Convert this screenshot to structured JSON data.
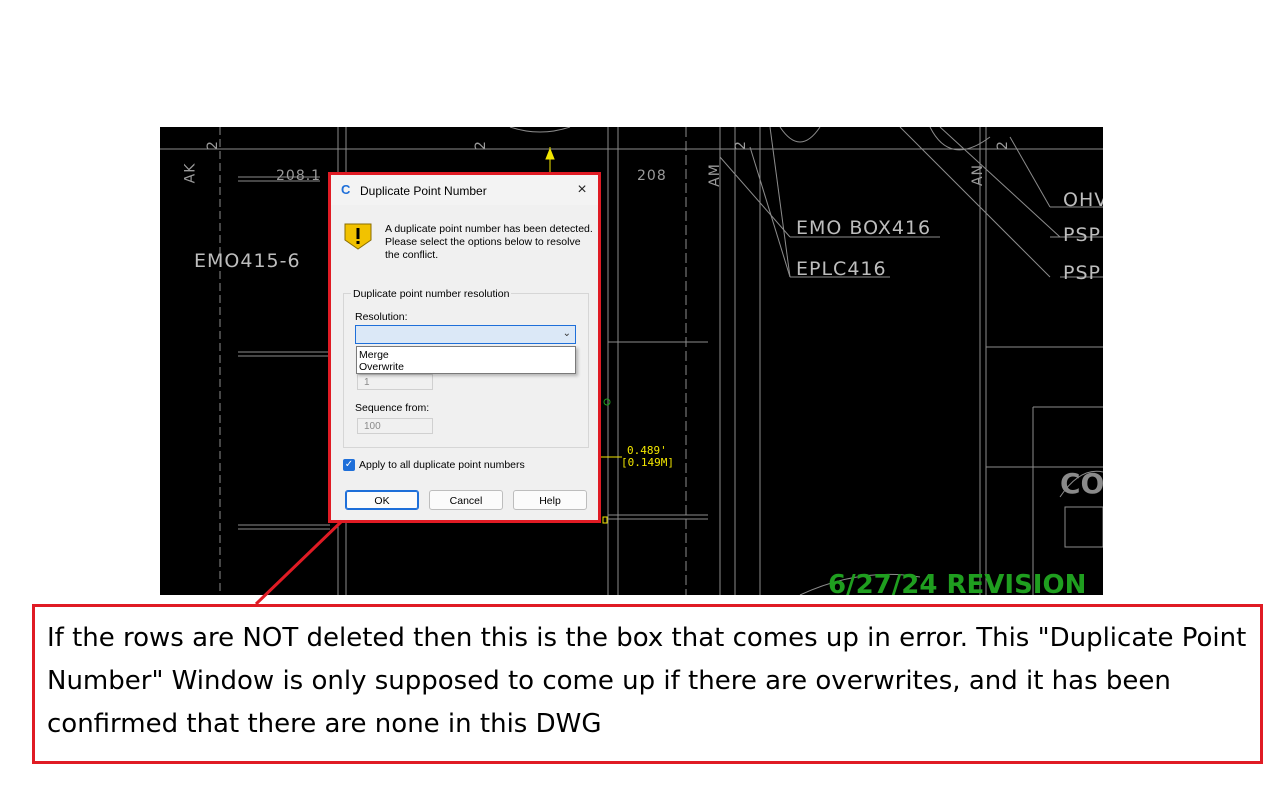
{
  "cad": {
    "labels": {
      "ak": "AK",
      "am": "AM",
      "an": "AN",
      "two_a": "2",
      "two_b": "2",
      "two_c": "2",
      "two_d": "2",
      "dim_208_left": "208.1",
      "dim_208_right": "208",
      "emo415": "EMO415-6",
      "emo_box": "EMO BOX416",
      "eplc": "EPLC416",
      "ohv": "OHV",
      "psp1": "PSP",
      "psp2": "PSP",
      "co": "CO",
      "dim_feet": "0.489'",
      "dim_meters": "[0.149M]",
      "revision": "6/27/24 REVISION"
    }
  },
  "dialog": {
    "title": "Duplicate Point Number",
    "app_icon": "C",
    "close_icon": "×",
    "message": "A duplicate point number has been detected.  Please select the options below to resolve the conflict.",
    "group_title": "Duplicate point number resolution",
    "resolution_label": "Resolution:",
    "resolution_value": "",
    "dropdown_options": [
      "Merge",
      "Overwrite"
    ],
    "hidden_field_value": "1",
    "sequence_label": "Sequence from:",
    "sequence_value": "100",
    "apply_all_label": "Apply to all duplicate point numbers",
    "apply_all_checked": true,
    "buttons": {
      "ok": "OK",
      "cancel": "Cancel",
      "help": "Help"
    },
    "accent_color": "#1e6fd9"
  },
  "callout": {
    "text": "If the rows are NOT deleted then this is the box that comes up in error. This \"Duplicate Point Number\" Window is only supposed to come up if there are overwrites, and it has been confirmed that there are none in this DWG",
    "border_color": "#e01b24"
  }
}
